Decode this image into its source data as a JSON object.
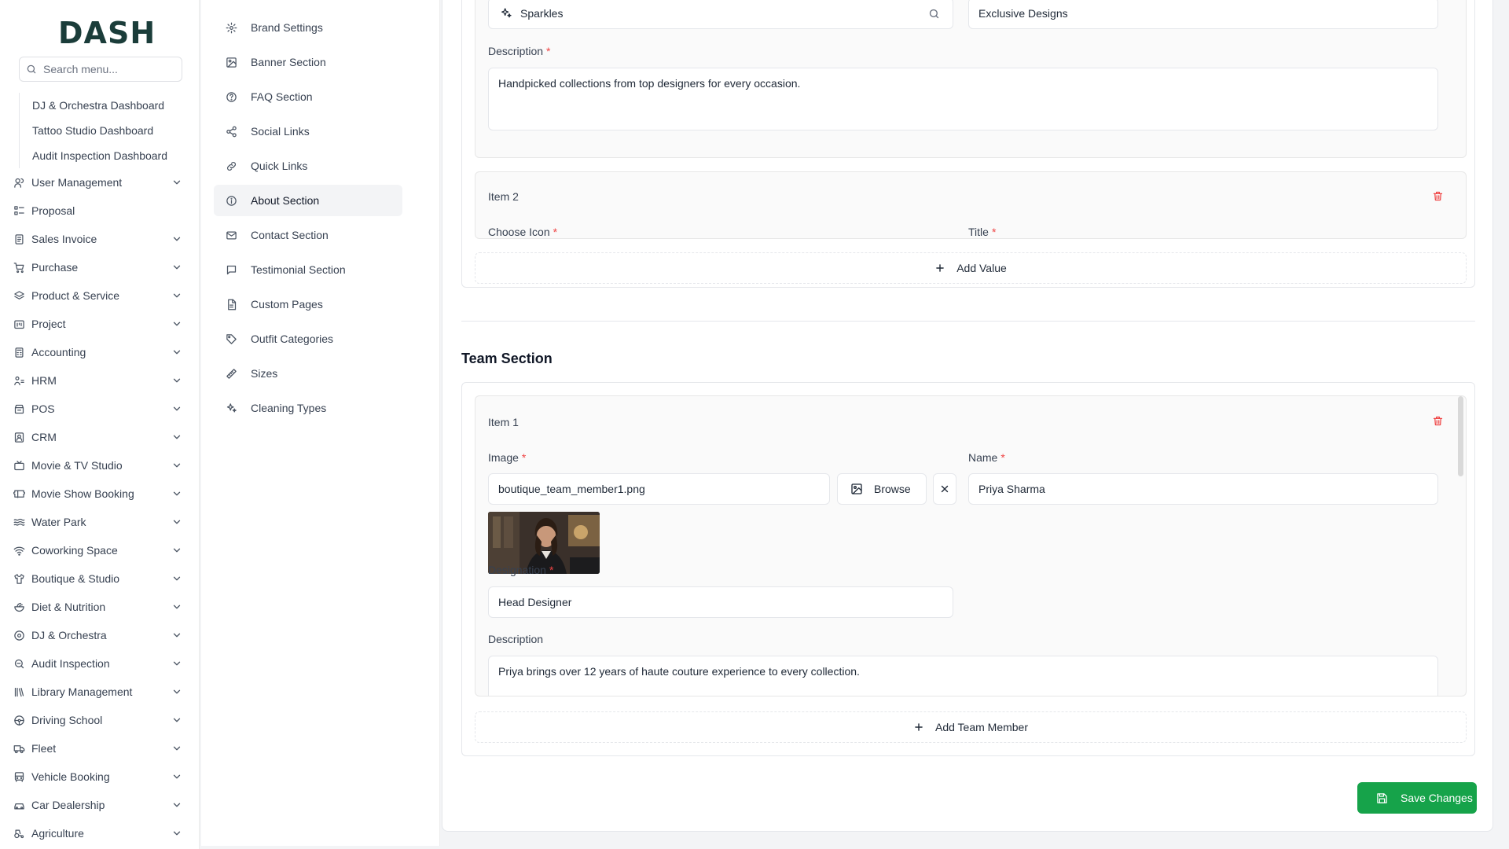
{
  "app": {
    "logo_text": "DASH"
  },
  "sidebar": {
    "search_placeholder": "Search menu...",
    "sub_items": [
      "DJ & Orchestra Dashboard",
      "Tattoo Studio Dashboard",
      "Audit Inspection Dashboard"
    ],
    "items": [
      {
        "label": "User Management",
        "icon": "users-icon",
        "expandable": true
      },
      {
        "label": "Proposal",
        "icon": "proposal-icon",
        "expandable": false
      },
      {
        "label": "Sales Invoice",
        "icon": "invoice-icon",
        "expandable": true
      },
      {
        "label": "Purchase",
        "icon": "cart-icon",
        "expandable": true
      },
      {
        "label": "Product & Service",
        "icon": "layers-icon",
        "expandable": true
      },
      {
        "label": "Project",
        "icon": "project-icon",
        "expandable": true
      },
      {
        "label": "Accounting",
        "icon": "calculator-icon",
        "expandable": true
      },
      {
        "label": "HRM",
        "icon": "hrm-icon",
        "expandable": true
      },
      {
        "label": "POS",
        "icon": "pos-icon",
        "expandable": true
      },
      {
        "label": "CRM",
        "icon": "crm-icon",
        "expandable": true
      },
      {
        "label": "Movie & TV Studio",
        "icon": "tv-icon",
        "expandable": true
      },
      {
        "label": "Movie Show Booking",
        "icon": "ticket-icon",
        "expandable": true
      },
      {
        "label": "Water Park",
        "icon": "waves-icon",
        "expandable": true
      },
      {
        "label": "Coworking Space",
        "icon": "wifi-icon",
        "expandable": true
      },
      {
        "label": "Boutique & Studio",
        "icon": "shirt-icon",
        "expandable": true
      },
      {
        "label": "Diet & Nutrition",
        "icon": "salad-icon",
        "expandable": true
      },
      {
        "label": "DJ & Orchestra",
        "icon": "disc-icon",
        "expandable": true
      },
      {
        "label": "Audit Inspection",
        "icon": "magnifier-icon",
        "expandable": true
      },
      {
        "label": "Library Management",
        "icon": "library-icon",
        "expandable": true
      },
      {
        "label": "Driving School",
        "icon": "steering-icon",
        "expandable": true
      },
      {
        "label": "Fleet",
        "icon": "truck-icon",
        "expandable": true
      },
      {
        "label": "Vehicle Booking",
        "icon": "bus-icon",
        "expandable": true
      },
      {
        "label": "Car Dealership",
        "icon": "car-icon",
        "expandable": true
      },
      {
        "label": "Agriculture",
        "icon": "tractor-icon",
        "expandable": true
      }
    ]
  },
  "settings_nav": {
    "items": [
      {
        "label": "Brand Settings",
        "icon": "gear-icon",
        "active": false
      },
      {
        "label": "Banner Section",
        "icon": "image-icon",
        "active": false
      },
      {
        "label": "FAQ Section",
        "icon": "help-circle-icon",
        "active": false
      },
      {
        "label": "Social Links",
        "icon": "share-icon",
        "active": false
      },
      {
        "label": "Quick Links",
        "icon": "link-icon",
        "active": false
      },
      {
        "label": "About Section",
        "icon": "info-icon",
        "active": true
      },
      {
        "label": "Contact Section",
        "icon": "mail-icon",
        "active": false
      },
      {
        "label": "Testimonial Section",
        "icon": "message-icon",
        "active": false
      },
      {
        "label": "Custom Pages",
        "icon": "file-icon",
        "active": false
      },
      {
        "label": "Outfit Categories",
        "icon": "tag-icon",
        "active": false
      },
      {
        "label": "Sizes",
        "icon": "ruler-icon",
        "active": false
      },
      {
        "label": "Cleaning Types",
        "icon": "sparkles-icon",
        "active": false
      }
    ]
  },
  "values_section": {
    "item1": {
      "choose_icon_value": "Sparkles",
      "title_value": "Exclusive Designs",
      "description_label": "Description",
      "description_value": "Handpicked collections from top designers for every occasion."
    },
    "item2": {
      "heading": "Item 2",
      "choose_icon_label": "Choose Icon",
      "title_label": "Title"
    },
    "add_label": "Add Value"
  },
  "team_section": {
    "title": "Team Section",
    "item1": {
      "heading": "Item 1",
      "image_label": "Image",
      "image_value": "boutique_team_member1.png",
      "browse_label": "Browse",
      "name_label": "Name",
      "name_value": "Priya Sharma",
      "designation_label": "Designation",
      "designation_value": "Head Designer",
      "description_label": "Description",
      "description_value": "Priya brings over 12 years of haute couture experience to every collection."
    },
    "add_label": "Add Team Member"
  },
  "save_label": "Save Changes",
  "colors": {
    "primary": "#16a34a",
    "danger": "#ef4444",
    "brand_text": "#1b3d3a"
  }
}
